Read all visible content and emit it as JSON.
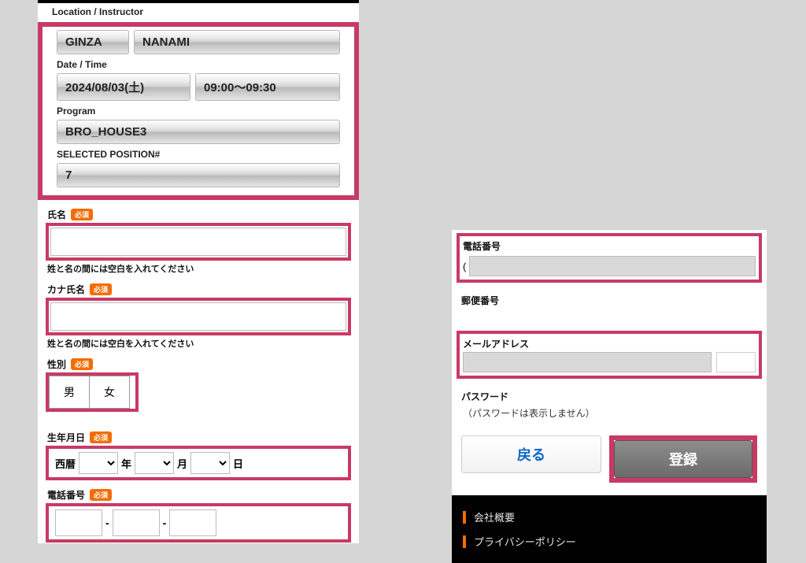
{
  "left": {
    "location_label": "Location / Instructor",
    "location": "GINZA",
    "instructor": "NANAMI",
    "date_label": "Date / Time",
    "date": "2024/08/03(土)",
    "time": "09:00〜09:30",
    "program_label": "Program",
    "program": "BRO_HOUSE3",
    "position_label": "SELECTED POSITION#",
    "position": "7",
    "name_label": "氏名",
    "name_hint": "姓と名の間には空白を入れてください",
    "kana_label": "カナ氏名",
    "kana_hint": "姓と名の間には空白を入れてください",
    "gender_label": "性別",
    "gender_male": "男",
    "gender_female": "女",
    "dob_label": "生年月日",
    "dob_era": "西暦",
    "dob_year_suffix": "年",
    "dob_month_suffix": "月",
    "dob_day_suffix": "日",
    "tel_label": "電話番号",
    "required_badge": "必須"
  },
  "right": {
    "tel_label": "電話番号",
    "tel_prefix": "(",
    "postal_label": "郵便番号",
    "email_label": "メールアドレス",
    "password_label": "パスワード",
    "password_note": "（パスワードは表示しません）",
    "back_btn": "戻る",
    "register_btn": "登録",
    "footer_company": "会社概要",
    "footer_privacy": "プライバシーポリシー"
  }
}
